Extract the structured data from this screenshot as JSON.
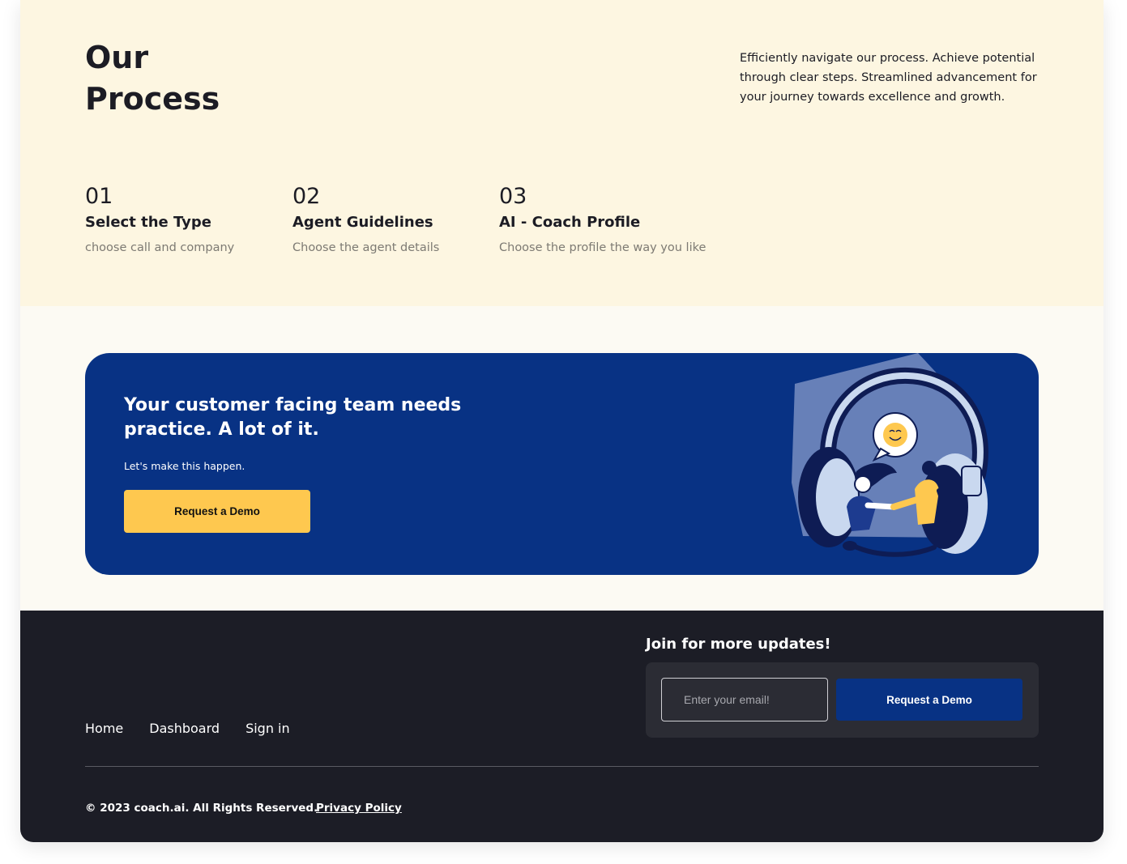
{
  "process": {
    "title_line1": "Our",
    "title_line2": "Process",
    "description": "Efficiently navigate our process. Achieve potential through clear steps. Streamlined advancement for your journey towards excellence and growth.",
    "steps": [
      {
        "number": "01",
        "title": "Select the Type",
        "subtitle": "choose call and company"
      },
      {
        "number": "02",
        "title": "Agent Guidelines",
        "subtitle": "Choose the agent details"
      },
      {
        "number": "03",
        "title": "AI - Coach Profile",
        "subtitle": "Choose the profile the way you like"
      }
    ]
  },
  "cta": {
    "heading": "Your customer facing team needs practice. A lot of it.",
    "subtext": "Let's make this happen.",
    "button_label": "Request a Demo",
    "illustration_icons": [
      "headset-icon",
      "smiley-speech-bubble-icon",
      "people-handshake-icon"
    ]
  },
  "footer": {
    "join_title": "Join for more updates!",
    "email_placeholder": "Enter your email!",
    "email_value": "",
    "button_label": "Request a Demo",
    "nav": [
      {
        "label": "Home"
      },
      {
        "label": "Dashboard"
      },
      {
        "label": "Sign in"
      }
    ],
    "copyright": "© 2023 coach.ai. All Rights Reserved.",
    "privacy_label": "Privacy Policy"
  },
  "colors": {
    "process_bg": "#fdf6e1",
    "cta_bg": "#083284",
    "accent_yellow": "#fec84f",
    "footer_bg": "#1c1d26",
    "footer_card": "#2b2c34"
  }
}
